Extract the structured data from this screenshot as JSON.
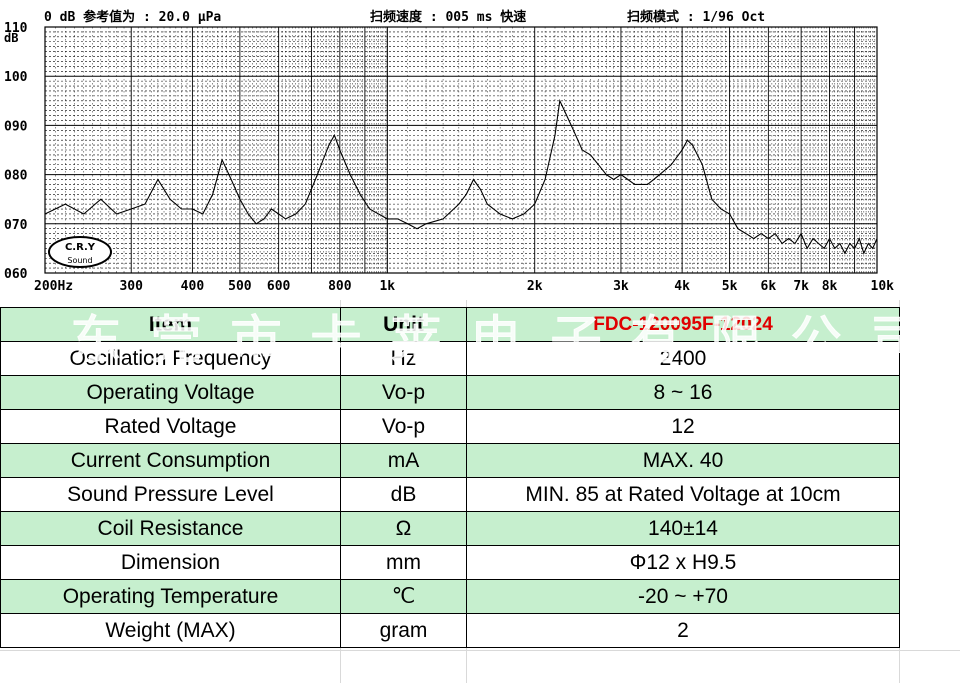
{
  "chart_data": {
    "type": "line",
    "header": {
      "ref": "0 dB 参考值为 : 20.0 μPa",
      "sweep": "扫频速度 : 005 ms 快速",
      "mode": "扫频模式 : 1/96  Oct"
    },
    "y_unit": "dB",
    "ylim": [
      60,
      110
    ],
    "y_ticks": [
      "110",
      "100",
      "090",
      "080",
      "070",
      "060"
    ],
    "xlim": [
      200,
      10000
    ],
    "x_scale": "log",
    "x_ticks": [
      {
        "v": 200,
        "label": "200Hz"
      },
      {
        "v": 300,
        "label": "300"
      },
      {
        "v": 400,
        "label": "400"
      },
      {
        "v": 500,
        "label": "500"
      },
      {
        "v": 600,
        "label": "600"
      },
      {
        "v": 800,
        "label": "800"
      },
      {
        "v": 1000,
        "label": "1k"
      },
      {
        "v": 2000,
        "label": "2k"
      },
      {
        "v": 3000,
        "label": "3k"
      },
      {
        "v": 4000,
        "label": "4k"
      },
      {
        "v": 5000,
        "label": "5k"
      },
      {
        "v": 6000,
        "label": "6k"
      },
      {
        "v": 7000,
        "label": "7k"
      },
      {
        "v": 8000,
        "label": "8k"
      },
      {
        "v": 10000,
        "label": "10k"
      }
    ],
    "grid": true,
    "logo": "C.R.Y Sound",
    "x": [
      200,
      220,
      240,
      260,
      280,
      300,
      320,
      340,
      360,
      380,
      400,
      420,
      440,
      460,
      480,
      500,
      520,
      540,
      560,
      580,
      600,
      620,
      650,
      680,
      720,
      760,
      780,
      800,
      840,
      880,
      920,
      960,
      1000,
      1050,
      1100,
      1150,
      1200,
      1300,
      1400,
      1450,
      1500,
      1550,
      1600,
      1700,
      1800,
      1900,
      2000,
      2100,
      2200,
      2250,
      2300,
      2400,
      2500,
      2600,
      2700,
      2800,
      2900,
      3000,
      3100,
      3200,
      3400,
      3600,
      3800,
      4000,
      4100,
      4200,
      4400,
      4600,
      4800,
      5000,
      5200,
      5400,
      5600,
      5800,
      6000,
      6200,
      6400,
      6600,
      6800,
      7000,
      7200,
      7400,
      7600,
      7800,
      8000,
      8200,
      8400,
      8600,
      8800,
      9000,
      9200,
      9400,
      9600,
      9800,
      10000
    ],
    "y": [
      72,
      74,
      72,
      75,
      72,
      73,
      74,
      79,
      75,
      73,
      73,
      72,
      76,
      83,
      79,
      75,
      72,
      70,
      71,
      73,
      72,
      71,
      72,
      74,
      80,
      86,
      88,
      85,
      80,
      76,
      73,
      72,
      71,
      71,
      70,
      69,
      70,
      71,
      74,
      76,
      79,
      77,
      74,
      72,
      71,
      72,
      74,
      79,
      88,
      95,
      93,
      89,
      85,
      84,
      82,
      80,
      79,
      80,
      79,
      78,
      78,
      80,
      82,
      85,
      87,
      86,
      82,
      75,
      73,
      72,
      69,
      68,
      67,
      68,
      67,
      68,
      66,
      67,
      66,
      68,
      65,
      67,
      66,
      65,
      67,
      65,
      66,
      64,
      66,
      65,
      67,
      64,
      66,
      65,
      67
    ]
  },
  "table": {
    "header": {
      "item": "Item",
      "unit": "Unit",
      "model": "FDC-120095F-12024"
    },
    "rows": [
      {
        "item": "Oscillation Frequency",
        "unit": "Hz",
        "value": "2400"
      },
      {
        "item": "Operating Voltage",
        "unit": "Vo-p",
        "value": "8 ~ 16"
      },
      {
        "item": "Rated Voltage",
        "unit": "Vo-p",
        "value": "12"
      },
      {
        "item": "Current Consumption",
        "unit": "mA",
        "value": "MAX. 40"
      },
      {
        "item": "Sound Pressure Level",
        "unit": "dB",
        "value": "MIN. 85 at Rated Voltage at 10cm"
      },
      {
        "item": "Coil Resistance",
        "unit": "Ω",
        "value": "140±14"
      },
      {
        "item": "Dimension",
        "unit": "mm",
        "value": "Φ12 x H9.5"
      },
      {
        "item": "Operating Temperature",
        "unit": "℃",
        "value": "-20 ~ +70"
      },
      {
        "item": "Weight (MAX)",
        "unit": "gram",
        "value": "2"
      }
    ]
  },
  "watermark": "东莞市卡莱电子有限公司",
  "colors": {
    "row_green": "#c6efce",
    "model_red": "#e00000",
    "grid": "#000000"
  }
}
